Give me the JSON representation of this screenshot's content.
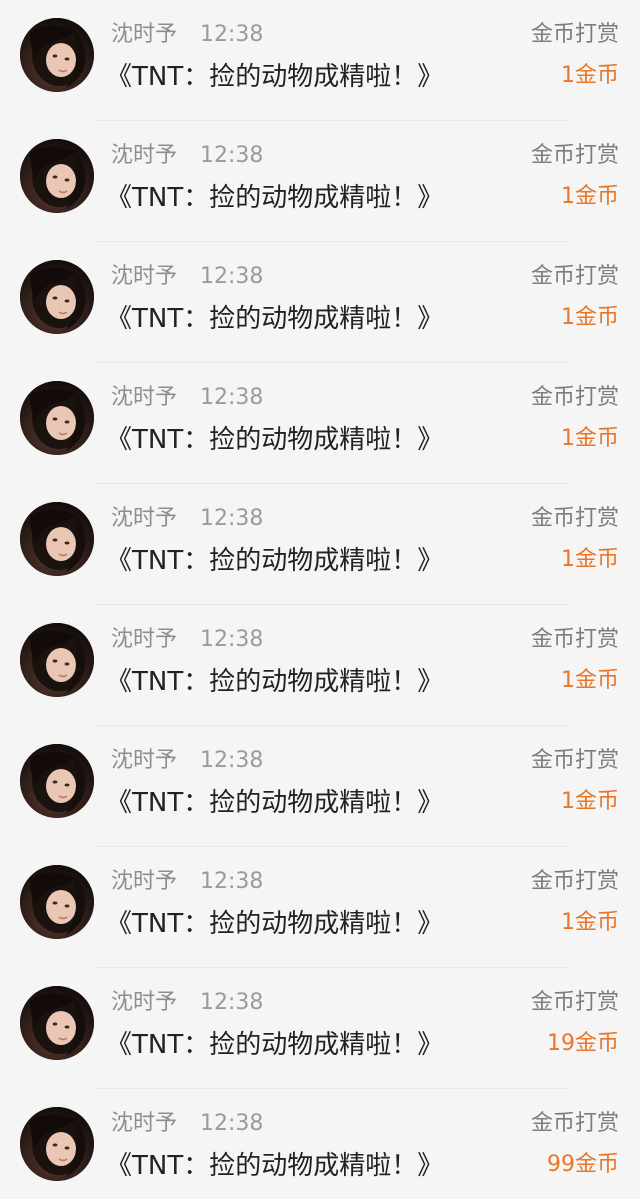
{
  "colors": {
    "background": "#f5f5f5",
    "name_text": "#8e8e8e",
    "time_text": "#9b9b9b",
    "title_text": "#222222",
    "kind_text": "#7d7d7d",
    "amount_accent": "#e97628",
    "divider": "#e9e9e9"
  },
  "rows": [
    {
      "avatar_icon": "user-avatar-photo",
      "name": "沈时予",
      "time": "12:38",
      "title": "《TNT：捡的动物成精啦！》",
      "reward_type": "金币打赏",
      "amount": "1金币"
    },
    {
      "avatar_icon": "user-avatar-photo",
      "name": "沈时予",
      "time": "12:38",
      "title": "《TNT：捡的动物成精啦！》",
      "reward_type": "金币打赏",
      "amount": "1金币"
    },
    {
      "avatar_icon": "user-avatar-photo",
      "name": "沈时予",
      "time": "12:38",
      "title": "《TNT：捡的动物成精啦！》",
      "reward_type": "金币打赏",
      "amount": "1金币"
    },
    {
      "avatar_icon": "user-avatar-photo",
      "name": "沈时予",
      "time": "12:38",
      "title": "《TNT：捡的动物成精啦！》",
      "reward_type": "金币打赏",
      "amount": "1金币"
    },
    {
      "avatar_icon": "user-avatar-photo",
      "name": "沈时予",
      "time": "12:38",
      "title": "《TNT：捡的动物成精啦！》",
      "reward_type": "金币打赏",
      "amount": "1金币"
    },
    {
      "avatar_icon": "user-avatar-photo",
      "name": "沈时予",
      "time": "12:38",
      "title": "《TNT：捡的动物成精啦！》",
      "reward_type": "金币打赏",
      "amount": "1金币"
    },
    {
      "avatar_icon": "user-avatar-photo",
      "name": "沈时予",
      "time": "12:38",
      "title": "《TNT：捡的动物成精啦！》",
      "reward_type": "金币打赏",
      "amount": "1金币"
    },
    {
      "avatar_icon": "user-avatar-photo",
      "name": "沈时予",
      "time": "12:38",
      "title": "《TNT：捡的动物成精啦！》",
      "reward_type": "金币打赏",
      "amount": "1金币"
    },
    {
      "avatar_icon": "user-avatar-photo",
      "name": "沈时予",
      "time": "12:38",
      "title": "《TNT：捡的动物成精啦！》",
      "reward_type": "金币打赏",
      "amount": "19金币"
    },
    {
      "avatar_icon": "user-avatar-photo",
      "name": "沈时予",
      "time": "12:38",
      "title": "《TNT：捡的动物成精啦！》",
      "reward_type": "金币打赏",
      "amount": "99金币"
    }
  ]
}
